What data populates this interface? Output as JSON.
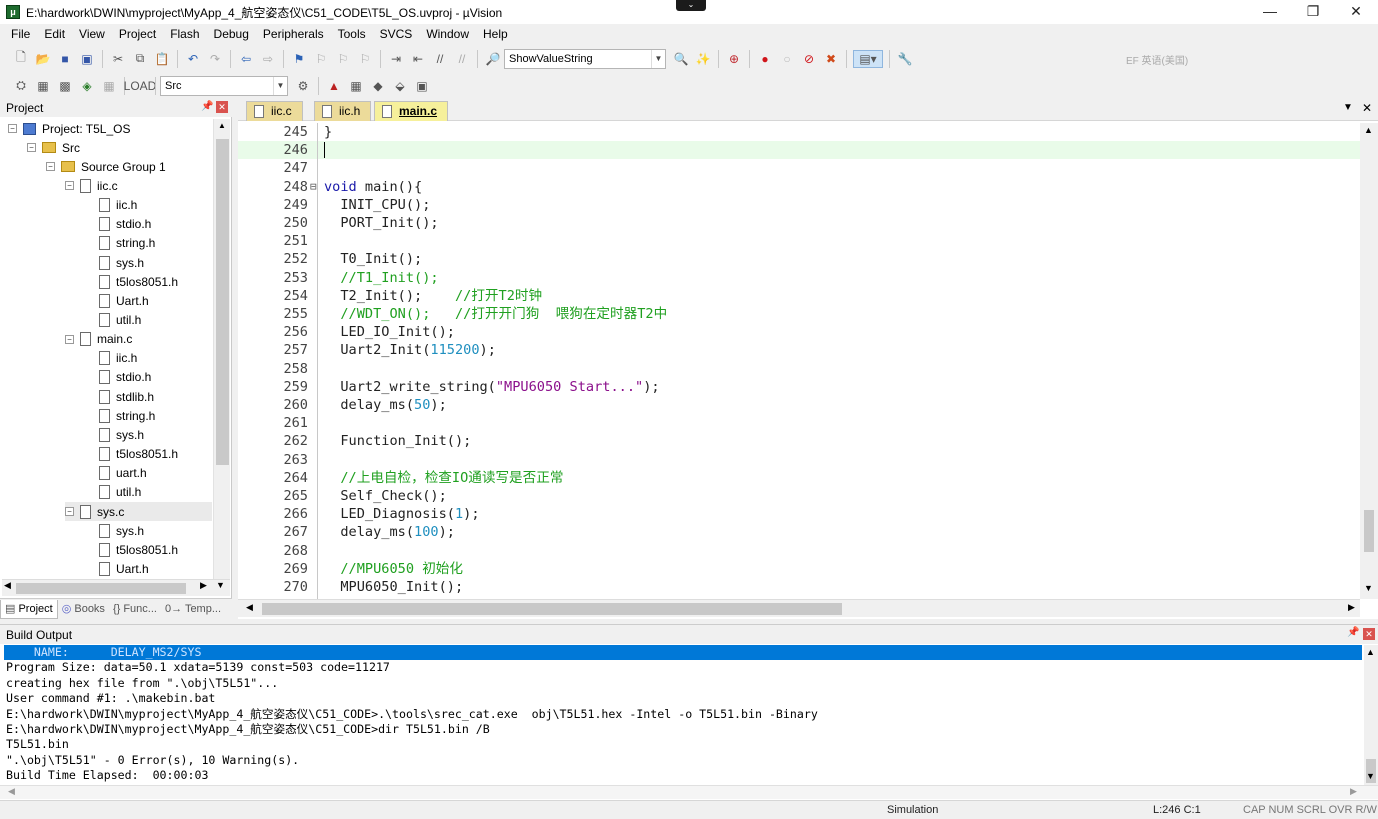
{
  "window": {
    "title": "E:\\hardwork\\DWIN\\myproject\\MyApp_4_航空姿态仪\\C51_CODE\\T5L_OS.uvproj - µVision",
    "min": "—",
    "restore": "❐",
    "close": "✕"
  },
  "menu": [
    "File",
    "Edit",
    "View",
    "Project",
    "Flash",
    "Debug",
    "Peripherals",
    "Tools",
    "SVCS",
    "Window",
    "Help"
  ],
  "toolbar1": {
    "find_combo": "ShowValueString",
    "ime_hint": "EF 英语(美国)"
  },
  "toolbar2": {
    "target_combo": "Src"
  },
  "project": {
    "header": "Project",
    "tree": [
      {
        "label": "Project: T5L_OS",
        "level": 0,
        "type": "proj",
        "exp": "−"
      },
      {
        "label": "Src",
        "level": 1,
        "type": "folder",
        "exp": "−"
      },
      {
        "label": "Source Group 1",
        "level": 2,
        "type": "folder",
        "exp": "−"
      },
      {
        "label": "iic.c",
        "level": 3,
        "type": "file",
        "exp": "−"
      },
      {
        "label": "iic.h",
        "level": 4,
        "type": "file"
      },
      {
        "label": "stdio.h",
        "level": 4,
        "type": "file"
      },
      {
        "label": "string.h",
        "level": 4,
        "type": "file"
      },
      {
        "label": "sys.h",
        "level": 4,
        "type": "file"
      },
      {
        "label": "t5los8051.h",
        "level": 4,
        "type": "file"
      },
      {
        "label": "Uart.h",
        "level": 4,
        "type": "file"
      },
      {
        "label": "util.h",
        "level": 4,
        "type": "file"
      },
      {
        "label": "main.c",
        "level": 3,
        "type": "file",
        "exp": "−"
      },
      {
        "label": "iic.h",
        "level": 4,
        "type": "file"
      },
      {
        "label": "stdio.h",
        "level": 4,
        "type": "file"
      },
      {
        "label": "stdlib.h",
        "level": 4,
        "type": "file"
      },
      {
        "label": "string.h",
        "level": 4,
        "type": "file"
      },
      {
        "label": "sys.h",
        "level": 4,
        "type": "file"
      },
      {
        "label": "t5los8051.h",
        "level": 4,
        "type": "file"
      },
      {
        "label": "uart.h",
        "level": 4,
        "type": "file"
      },
      {
        "label": "util.h",
        "level": 4,
        "type": "file"
      },
      {
        "label": "sys.c",
        "level": 3,
        "type": "file",
        "exp": "−"
      },
      {
        "label": "sys.h",
        "level": 4,
        "type": "file"
      },
      {
        "label": "t5los8051.h",
        "level": 4,
        "type": "file"
      },
      {
        "label": "Uart.h",
        "level": 4,
        "type": "file"
      }
    ],
    "tabs": [
      "Project",
      "Books",
      "{} Func...",
      "0→ Temp..."
    ]
  },
  "editor": {
    "tabs": [
      "iic.c",
      "iic.h",
      "main.c"
    ],
    "active_tab": "main.c",
    "lines": [
      {
        "n": "245",
        "parts": [
          [
            "}",
            ""
          ]
        ]
      },
      {
        "n": "246",
        "parts": [
          [
            "",
            ""
          ]
        ],
        "current": true
      },
      {
        "n": "247",
        "parts": [
          [
            "",
            ""
          ]
        ]
      },
      {
        "n": "248",
        "parts": [
          [
            "void",
            "kw"
          ],
          [
            " main(){",
            ""
          ]
        ],
        "fold": true
      },
      {
        "n": "249",
        "parts": [
          [
            "  INIT_CPU();",
            ""
          ]
        ]
      },
      {
        "n": "250",
        "parts": [
          [
            "  PORT_Init();",
            ""
          ]
        ]
      },
      {
        "n": "251",
        "parts": [
          [
            "",
            ""
          ]
        ]
      },
      {
        "n": "252",
        "parts": [
          [
            "  T0_Init();",
            ""
          ]
        ]
      },
      {
        "n": "253",
        "parts": [
          [
            "  //T1_Init();",
            "cm"
          ]
        ]
      },
      {
        "n": "254",
        "parts": [
          [
            "  T2_Init();    ",
            ""
          ],
          [
            "//打开T2时钟",
            "cm"
          ]
        ]
      },
      {
        "n": "255",
        "parts": [
          [
            "  //WDT_ON();   //打开开门狗  喂狗在定时器T2中",
            "cm"
          ]
        ]
      },
      {
        "n": "256",
        "parts": [
          [
            "  LED_IO_Init();",
            ""
          ]
        ]
      },
      {
        "n": "257",
        "parts": [
          [
            "  Uart2_Init(",
            ""
          ],
          [
            "115200",
            "nm"
          ],
          [
            ");",
            ""
          ]
        ]
      },
      {
        "n": "258",
        "parts": [
          [
            "",
            ""
          ]
        ]
      },
      {
        "n": "259",
        "parts": [
          [
            "  Uart2_write_string(",
            ""
          ],
          [
            "\"MPU6050 Start...\"",
            "st"
          ],
          [
            ");",
            ""
          ]
        ]
      },
      {
        "n": "260",
        "parts": [
          [
            "  delay_ms(",
            ""
          ],
          [
            "50",
            "nm"
          ],
          [
            ");",
            ""
          ]
        ]
      },
      {
        "n": "261",
        "parts": [
          [
            "",
            ""
          ]
        ]
      },
      {
        "n": "262",
        "parts": [
          [
            "  Function_Init();",
            ""
          ]
        ]
      },
      {
        "n": "263",
        "parts": [
          [
            "",
            ""
          ]
        ]
      },
      {
        "n": "264",
        "parts": [
          [
            "  //上电自检，检查IO通读写是否正常",
            "cm"
          ]
        ]
      },
      {
        "n": "265",
        "parts": [
          [
            "  Self_Check();",
            ""
          ]
        ]
      },
      {
        "n": "266",
        "parts": [
          [
            "  LED_Diagnosis(",
            ""
          ],
          [
            "1",
            "nm"
          ],
          [
            ");",
            ""
          ]
        ]
      },
      {
        "n": "267",
        "parts": [
          [
            "  delay_ms(",
            ""
          ],
          [
            "100",
            "nm"
          ],
          [
            ");",
            ""
          ]
        ]
      },
      {
        "n": "268",
        "parts": [
          [
            "",
            ""
          ]
        ]
      },
      {
        "n": "269",
        "parts": [
          [
            "  //MPU6050 初始化",
            "cm"
          ]
        ]
      },
      {
        "n": "270",
        "parts": [
          [
            "  MPU6050_Init();",
            ""
          ]
        ]
      }
    ]
  },
  "build": {
    "header": "Build Output",
    "lines": [
      "    NAME:      DELAY_MS2/SYS",
      "Program Size: data=50.1 xdata=5139 const=503 code=11217",
      "creating hex file from \".\\obj\\T5L51\"...",
      "User command #1: .\\makebin.bat",
      "E:\\hardwork\\DWIN\\myproject\\MyApp_4_航空姿态仪\\C51_CODE>.\\tools\\srec_cat.exe  obj\\T5L51.hex -Intel -o T5L51.bin -Binary",
      "E:\\hardwork\\DWIN\\myproject\\MyApp_4_航空姿态仪\\C51_CODE>dir T5L51.bin /B",
      "T5L51.bin",
      "\".\\obj\\T5L51\" - 0 Error(s), 10 Warning(s).",
      "Build Time Elapsed:  00:00:03"
    ]
  },
  "status": {
    "mode": "Simulation",
    "position": "L:246 C:1",
    "indicators": "CAP  NUM  SCRL  OVR  R/W"
  }
}
